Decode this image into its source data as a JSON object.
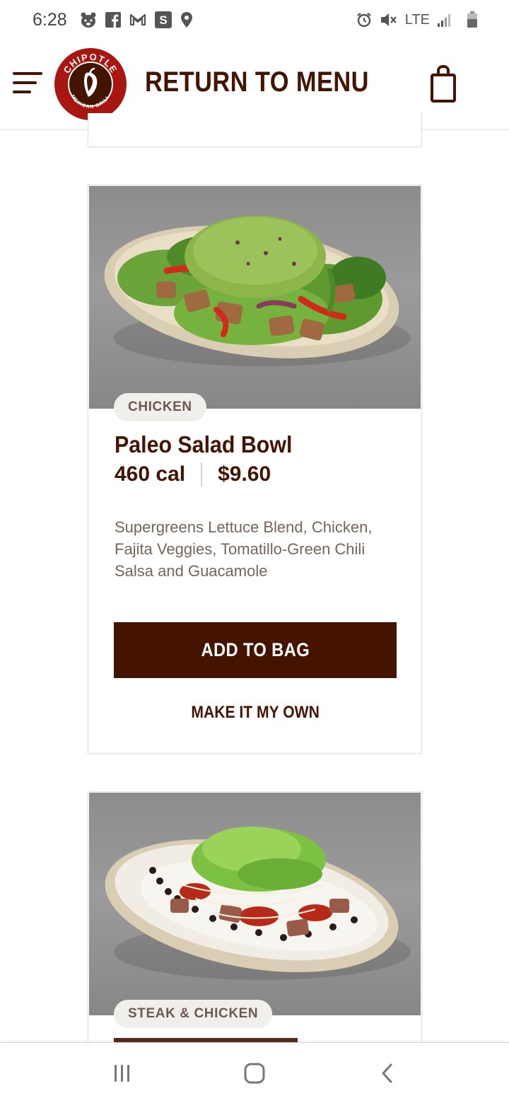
{
  "status_bar": {
    "time": "6:28",
    "left_icons": [
      "bear-app-icon",
      "facebook-icon",
      "gmail-icon",
      "s-app-icon",
      "location-icon"
    ],
    "right_icons": [
      "alarm-icon",
      "mute-icon",
      "signal-icon",
      "battery-icon"
    ],
    "network": "LTE"
  },
  "header": {
    "title": "RETURN TO MENU",
    "logo_text_top": "CHIPOTLE",
    "logo_text_bottom": "MEXICAN GRILL"
  },
  "menu_items": [
    {
      "tag": "CHICKEN",
      "name": "Paleo Salad Bowl",
      "calories": "460 cal",
      "price": "$9.60",
      "description": "Supergreens Lettuce Blend, Chicken, Fajita Veggies, Tomatillo-Green Chili Salsa and Guacamole",
      "add_label": "ADD TO BAG",
      "customize_label": "MAKE IT MY OWN"
    },
    {
      "tag": "STEAK & CHICKEN"
    }
  ],
  "colors": {
    "brand_brown": "#451400",
    "logo_red": "#a81612",
    "tag_bg": "#f1efec"
  }
}
